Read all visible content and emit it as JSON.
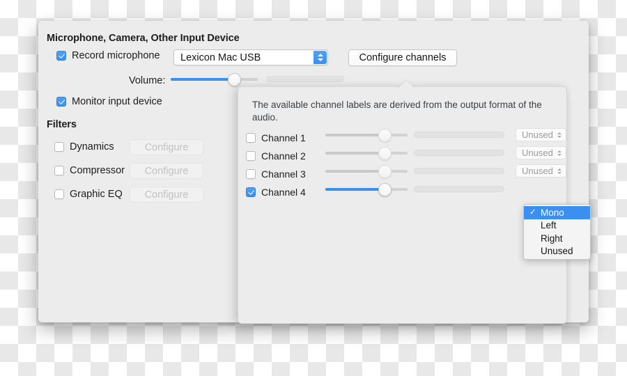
{
  "window": {
    "input_section_title": "Microphone, Camera, Other Input Device",
    "record_mic": {
      "label": "Record microphone",
      "checked": true,
      "device_value": "Lexicon Mac USB"
    },
    "configure_channels_button": "Configure channels",
    "volume": {
      "label": "Volume:",
      "level_percent": 72
    },
    "monitor_input": {
      "label": "Monitor input device",
      "checked": true
    },
    "filters": {
      "title": "Filters",
      "configure_label": "Configure",
      "items": [
        {
          "label": "Dynamics",
          "checked": false,
          "button": "Configure",
          "enabled": false
        },
        {
          "label": "Compressor",
          "checked": false,
          "button": "Configure",
          "enabled": false
        },
        {
          "label": "Graphic EQ",
          "checked": false,
          "button": "Configure",
          "enabled": false
        }
      ]
    }
  },
  "popover": {
    "description": "The available channel labels are derived from the output format of the audio.",
    "channels": [
      {
        "label": "Channel 1",
        "checked": false,
        "gain_percent": 72,
        "meter_percent": 0,
        "assignment": "Unused"
      },
      {
        "label": "Channel 2",
        "checked": false,
        "gain_percent": 72,
        "meter_percent": 0,
        "assignment": "Unused"
      },
      {
        "label": "Channel 3",
        "checked": false,
        "gain_percent": 72,
        "meter_percent": 0,
        "assignment": "Unused"
      },
      {
        "label": "Channel 4",
        "checked": true,
        "gain_percent": 72,
        "meter_percent": 0,
        "assignment": "Mono"
      }
    ]
  },
  "dropdown_menu": {
    "open": true,
    "checkmark": "✓",
    "selected": "Mono",
    "items": [
      "Mono",
      "Left",
      "Right",
      "Unused"
    ]
  },
  "colors": {
    "accent": "#3b8ff0",
    "window_bg": "#ececec",
    "popover_bg": "#ececec",
    "text": "#1d1d1d",
    "disabled_text": "#c2c2c2"
  }
}
